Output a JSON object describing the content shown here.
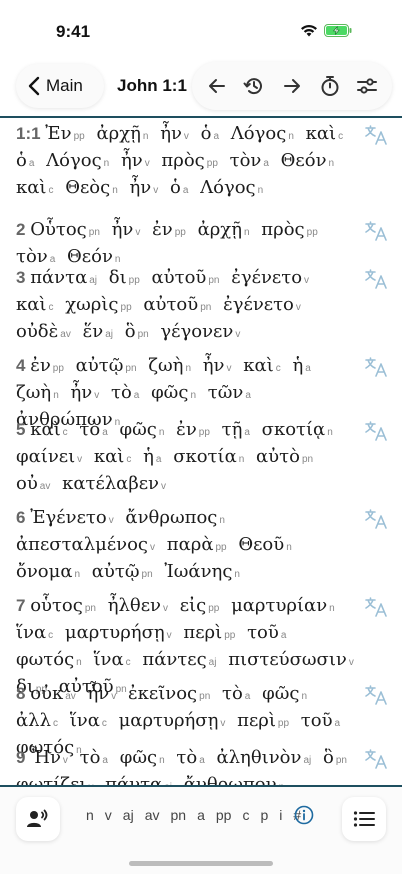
{
  "status": {
    "time": "9:41"
  },
  "nav": {
    "back_label": "Main",
    "title": "John 1:1"
  },
  "colors": {
    "accent_rule": "#1e4f5f",
    "translate_icon": "#9bbfd6"
  },
  "verses": [
    {
      "num": "1:1",
      "words": [
        [
          "Ἐν",
          "pp"
        ],
        [
          "ἀρχῇ",
          "n"
        ],
        [
          "ἦν",
          "v"
        ],
        [
          "ὁ",
          "a"
        ],
        [
          "Λόγος",
          "n"
        ],
        [
          "καὶ",
          "c"
        ],
        [
          "ὁ",
          "a"
        ],
        [
          "Λόγος",
          "n"
        ],
        [
          "ἦν",
          "v"
        ],
        [
          "πρὸς",
          "pp"
        ],
        [
          "τὸν",
          "a"
        ],
        [
          "Θεόν",
          "n"
        ],
        [
          "καὶ",
          "c"
        ],
        [
          "Θεὸς",
          "n"
        ],
        [
          "ἦν",
          "v"
        ],
        [
          "ὁ",
          "a"
        ],
        [
          "Λόγος",
          "n"
        ]
      ]
    },
    {
      "num": "2",
      "words": [
        [
          "Οὗτος",
          "pn"
        ],
        [
          "ἦν",
          "v"
        ],
        [
          "ἐν",
          "pp"
        ],
        [
          "ἀρχῇ",
          "n"
        ],
        [
          "πρὸς",
          "pp"
        ],
        [
          "τὸν",
          "a"
        ],
        [
          "Θεόν",
          "n"
        ]
      ]
    },
    {
      "num": "3",
      "words": [
        [
          "πάντα",
          "aj"
        ],
        [
          "δι",
          "pp"
        ],
        [
          "αὐτοῦ",
          "pn"
        ],
        [
          "ἐγένετο",
          "v"
        ],
        [
          "καὶ",
          "c"
        ],
        [
          "χωρὶς",
          "pp"
        ],
        [
          "αὐτοῦ",
          "pn"
        ],
        [
          "ἐγένετο",
          "v"
        ],
        [
          "οὐδὲ",
          "av"
        ],
        [
          "ἕν",
          "aj"
        ],
        [
          "ὃ",
          "pn"
        ],
        [
          "γέγονεν",
          "v"
        ]
      ]
    },
    {
      "num": "4",
      "words": [
        [
          "ἐν",
          "pp"
        ],
        [
          "αὐτῷ",
          "pn"
        ],
        [
          "ζωὴ",
          "n"
        ],
        [
          "ἦν",
          "v"
        ],
        [
          "καὶ",
          "c"
        ],
        [
          "ἡ",
          "a"
        ],
        [
          "ζωὴ",
          "n"
        ],
        [
          "ἦν",
          "v"
        ],
        [
          "τὸ",
          "a"
        ],
        [
          "φῶς",
          "n"
        ],
        [
          "τῶν",
          "a"
        ],
        [
          "ἀνθρώπων",
          "n"
        ]
      ]
    },
    {
      "num": "5",
      "words": [
        [
          "καὶ",
          "c"
        ],
        [
          "τὸ",
          "a"
        ],
        [
          "φῶς",
          "n"
        ],
        [
          "ἐν",
          "pp"
        ],
        [
          "τῇ",
          "a"
        ],
        [
          "σκοτίᾳ",
          "n"
        ],
        [
          "φαίνει",
          "v"
        ],
        [
          "καὶ",
          "c"
        ],
        [
          "ἡ",
          "a"
        ],
        [
          "σκοτία",
          "n"
        ],
        [
          "αὐτὸ",
          "pn"
        ],
        [
          "οὐ",
          "av"
        ],
        [
          "κατέλαβεν",
          "v"
        ]
      ]
    },
    {
      "num": "6",
      "words": [
        [
          "Ἐγένετο",
          "v"
        ],
        [
          "ἄνθρωπος",
          "n"
        ],
        [
          "ἀπεσταλμένος",
          "v"
        ],
        [
          "παρὰ",
          "pp"
        ],
        [
          "Θεοῦ",
          "n"
        ],
        [
          "ὄνομα",
          "n"
        ],
        [
          "αὐτῷ",
          "pn"
        ],
        [
          "Ἰωάνης",
          "n"
        ]
      ]
    },
    {
      "num": "7",
      "words": [
        [
          "οὗτος",
          "pn"
        ],
        [
          "ἦλθεν",
          "v"
        ],
        [
          "εἰς",
          "pp"
        ],
        [
          "μαρτυρίαν",
          "n"
        ],
        [
          "ἵνα",
          "c"
        ],
        [
          "μαρτυρήσῃ",
          "v"
        ],
        [
          "περὶ",
          "pp"
        ],
        [
          "τοῦ",
          "a"
        ],
        [
          "φωτός",
          "n"
        ],
        [
          "ἵνα",
          "c"
        ],
        [
          "πάντες",
          "aj"
        ],
        [
          "πιστεύσωσιν",
          "v"
        ],
        [
          "δι",
          "pp"
        ],
        [
          "αὐτοῦ",
          "pn"
        ]
      ]
    },
    {
      "num": "8",
      "words": [
        [
          "οὐκ",
          "av"
        ],
        [
          "ἦν",
          "v"
        ],
        [
          "ἐκεῖνος",
          "pn"
        ],
        [
          "τὸ",
          "a"
        ],
        [
          "φῶς",
          "n"
        ],
        [
          "ἀλλ",
          "c"
        ],
        [
          "ἵνα",
          "c"
        ],
        [
          "μαρτυρήσῃ",
          "v"
        ],
        [
          "περὶ",
          "pp"
        ],
        [
          "τοῦ",
          "a"
        ],
        [
          "φωτός",
          "n"
        ]
      ]
    },
    {
      "num": "9",
      "words": [
        [
          "Ἦν",
          "v"
        ],
        [
          "τὸ",
          "a"
        ],
        [
          "φῶς",
          "n"
        ],
        [
          "τὸ",
          "a"
        ],
        [
          "ἀληθινὸν",
          "aj"
        ],
        [
          "ὃ",
          "pn"
        ],
        [
          "φωτίζει",
          "v"
        ],
        [
          "πάντα",
          "aj"
        ],
        [
          "ἄνθρωπον",
          "n"
        ]
      ]
    }
  ],
  "pos_filters": [
    "n",
    "v",
    "aj",
    "av",
    "pn",
    "a",
    "pp",
    "c",
    "p",
    "i",
    "#"
  ],
  "icons": {
    "back": "chevron-left-icon",
    "prev": "arrow-left-icon",
    "history": "history-icon",
    "next": "arrow-right-icon",
    "timer": "stopwatch-icon",
    "settings": "sliders-icon",
    "translate": "translate-icon",
    "audio": "speaker-person-icon",
    "info": "info-icon",
    "list": "list-icon"
  }
}
